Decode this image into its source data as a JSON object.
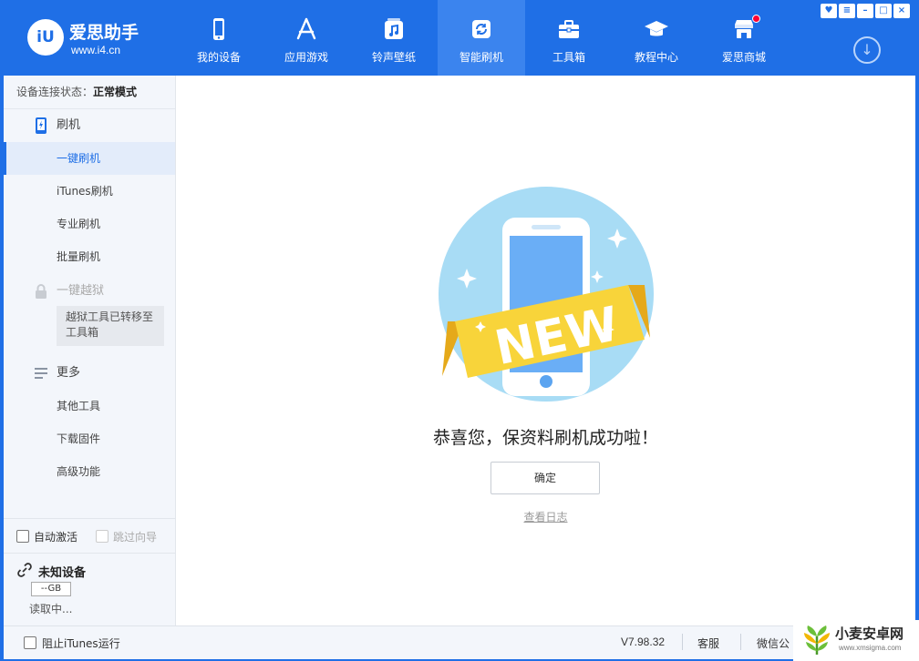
{
  "app": {
    "logo_name": "爱思助手",
    "logo_mark": "iU",
    "logo_url": "www.i4.cn"
  },
  "nav": {
    "items": [
      {
        "label": "我的设备",
        "icon": "phone-icon"
      },
      {
        "label": "应用游戏",
        "icon": "app-store-icon"
      },
      {
        "label": "铃声壁纸",
        "icon": "music-icon"
      },
      {
        "label": "智能刷机",
        "icon": "refresh-icon",
        "active": true
      },
      {
        "label": "工具箱",
        "icon": "toolbox-icon"
      },
      {
        "label": "教程中心",
        "icon": "graduation-cap-icon"
      },
      {
        "label": "爱思商城",
        "icon": "store-icon",
        "has_badge": true
      }
    ],
    "download_icon": "download-icon"
  },
  "sidebar": {
    "status_label": "设备连接状态：",
    "status_value": "正常模式",
    "flash_section": "刷机",
    "flash_items": [
      "一键刷机",
      "iTunes刷机",
      "专业刷机",
      "批量刷机"
    ],
    "jailbreak_section": "一键越狱",
    "jailbreak_note": "越狱工具已转移至工具箱",
    "more_section": "更多",
    "more_items": [
      "其他工具",
      "下载固件",
      "高级功能"
    ],
    "auto_activate": "自动激活",
    "skip_guide": "跳过向导",
    "device_name": "未知设备",
    "device_capacity": "--GB",
    "device_status": "读取中..."
  },
  "main": {
    "badge_text": "NEW",
    "success_message": "恭喜您，保资料刷机成功啦！",
    "ok_button": "确定",
    "view_log": "查看日志"
  },
  "footer": {
    "block_itunes": "阻止iTunes运行",
    "version": "V7.98.32",
    "customer_service": "客服",
    "wechat": "微信公"
  },
  "watermark": {
    "name": "小麦安卓网",
    "url": "www.xmsigma.com"
  },
  "colors": {
    "brand_blue": "#1f6fe6",
    "active_nav": "#3b84ee",
    "ribbon_yellow": "#f8d43a"
  }
}
